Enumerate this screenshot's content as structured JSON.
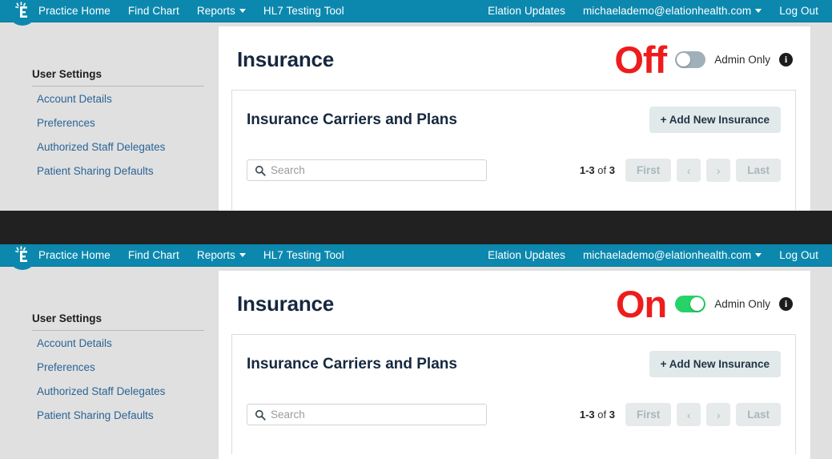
{
  "navbar": {
    "logo_icon": "elation-logo-icon",
    "left_items": [
      "Practice Home",
      "Find Chart",
      "Reports",
      "HL7 Testing Tool"
    ],
    "reports_has_caret": true,
    "right_items": [
      "Elation Updates",
      "michaelademo@elationhealth.com",
      "Log Out"
    ],
    "account_has_caret": true
  },
  "sidebar": {
    "title": "User Settings",
    "items": [
      {
        "label": "Account Details"
      },
      {
        "label": "Preferences"
      },
      {
        "label": "Authorized Staff Delegates"
      },
      {
        "label": "Patient Sharing Defaults"
      }
    ]
  },
  "panel_off": {
    "page_title": "Insurance",
    "state_word": "Off",
    "state_color": "#ee1c1c",
    "toggle_state": "off",
    "toggle_color": "#9fb0b8",
    "admin_label": "Admin Only",
    "info_icon": "info-icon",
    "section_title": "Insurance Carriers and Plans",
    "add_button": "+ Add New Insurance",
    "search_placeholder": "Search",
    "search_value": "",
    "search_icon": "search-icon",
    "pager": {
      "range": "1-3",
      "of": "of",
      "total": "3",
      "first": "First",
      "prev": "‹",
      "next": "›",
      "last": "Last"
    }
  },
  "panel_on": {
    "page_title": "Insurance",
    "state_word": "On",
    "state_color": "#ee1c1c",
    "toggle_state": "on",
    "toggle_color": "#25d366",
    "admin_label": "Admin Only",
    "info_icon": "info-icon",
    "section_title": "Insurance Carriers and Plans",
    "add_button": "+ Add New Insurance",
    "search_placeholder": "Search",
    "search_value": "",
    "search_icon": "search-icon",
    "pager": {
      "range": "1-3",
      "of": "of",
      "total": "3",
      "first": "First",
      "prev": "‹",
      "next": "›",
      "last": "Last"
    }
  },
  "theme": {
    "navbar_bg": "#0c88ae",
    "page_bg": "#e0e0e0",
    "card_bg": "#ffffff",
    "link_color": "#2a6496",
    "title_color": "#16283f",
    "divider_band_color": "#212121"
  }
}
